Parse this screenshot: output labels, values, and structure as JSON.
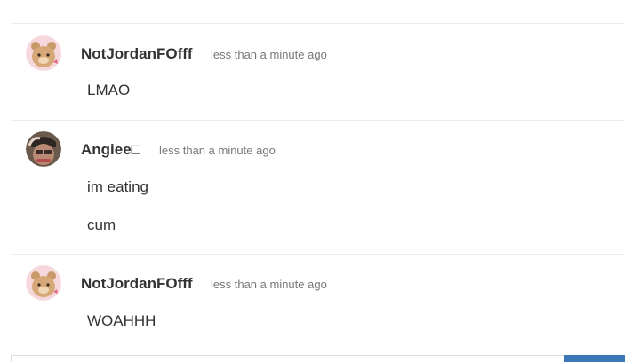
{
  "messages": [
    {
      "username": "NotJordanFOfff",
      "timestamp": "less than a minute ago",
      "lines": [
        "LMAO"
      ],
      "avatar": "bear-avatar"
    },
    {
      "username": "Angiee□",
      "timestamp": "less than a minute ago",
      "lines": [
        "im eating",
        "cum"
      ],
      "avatar": "photo-avatar"
    },
    {
      "username": "NotJordanFOfff",
      "timestamp": "less than a minute ago",
      "lines": [
        "WOAHHH"
      ],
      "avatar": "bear-avatar"
    }
  ],
  "colors": {
    "accent": "#3a78b8",
    "divider": "#ececec",
    "timestamp": "#777777"
  }
}
